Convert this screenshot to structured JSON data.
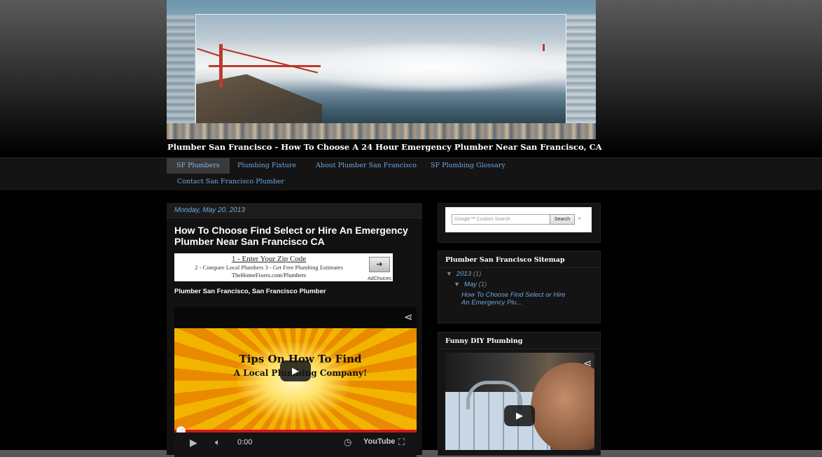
{
  "header": {
    "image_alt": "Golden Gate Bridge in fog header image",
    "blog_title": "Plumber San Francisco - How To Choose A 24 Hour Emergency Plumber Near San Francisco, CA"
  },
  "nav": {
    "items": [
      {
        "label": "SF Plumbers",
        "active": true
      },
      {
        "label": "Plumbing Fixture"
      },
      {
        "label": "About Plumber San Francisco"
      },
      {
        "label": "SF Plumbing Glossary"
      },
      {
        "label": "Contact San Francisco Plumber"
      }
    ]
  },
  "post": {
    "date": "Monday, May 20, 2013",
    "title": "How To Choose Find Select or Hire An Emergency Plumber Near San Francisco CA",
    "subtitle": "Plumber San Francisco, San Francisco Plumber",
    "ad": {
      "line1": "1 - Enter Your Zip Code",
      "line2": "2 - Compare Local Plumbers 3 - Get Free Plumbing Estimates",
      "line3": "TheHomeFixers.com/Plumbers",
      "adchoices": "AdChoices"
    },
    "video": {
      "overlay_line1": "Tips On How To Find",
      "overlay_line2": "A Local Plumbing Company!",
      "time": "0:00",
      "youtube_label": "YouTube",
      "progress": 0
    }
  },
  "sidebar": {
    "search": {
      "placeholder": "Google™ Custom Search",
      "button": "Search",
      "clear": "×"
    },
    "sitemap": {
      "title": "Plumber San Francisco Sitemap",
      "year": "2013",
      "year_count": "(1)",
      "month": "May",
      "month_count": "(1)",
      "post_link": "How To Choose Find Select or Hire An Emergency Plu..."
    },
    "funny": {
      "title": "Funny DIY Plumbing"
    }
  },
  "icons": {
    "share": "share-icon",
    "play": "play-icon",
    "volume": "volume-icon",
    "clock": "clock-icon",
    "fullscreen": "fullscreen-icon",
    "expand": "triangle-down-icon"
  }
}
